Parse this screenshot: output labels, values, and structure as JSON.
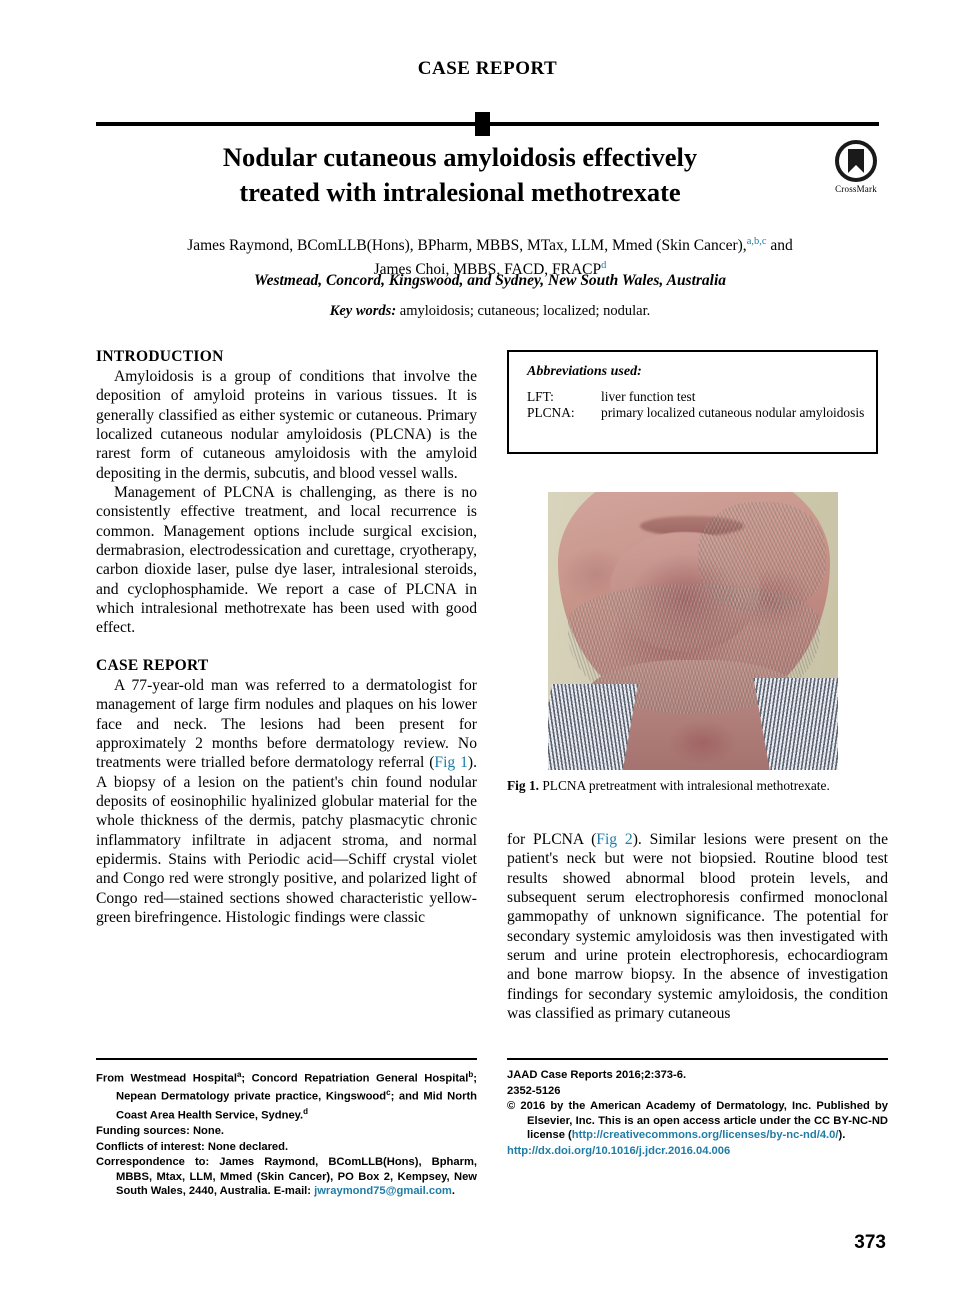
{
  "header": {
    "kicker": "CASE REPORT",
    "title_line1": "Nodular cutaneous amyloidosis effectively",
    "title_line2": "treated with intralesional methotrexate",
    "crossmark_label": "CrossMark",
    "authors_line1": "James Raymond, BComLLB(Hons), BPharm, MBBS, MTax, LLM, Mmed (Skin Cancer),",
    "authors_sup1": "a,b,c",
    "authors_and": " and",
    "authors_line2": "James Choi, MBBS, FACD, FRACP",
    "authors_sup2": "d",
    "affiliation": "Westmead, Concord, Kingswood, and Sydney, New South Wales, Australia",
    "keywords_label": "Key words:",
    "keywords_value": " amyloidosis; cutaneous; localized; nodular."
  },
  "left_column": {
    "intro_heading": "INTRODUCTION",
    "intro_p1": "Amyloidosis is a group of conditions that involve the deposition of amyloid proteins in various tissues. It is generally classified as either systemic or cutaneous. Primary localized cutaneous nodular amyloidosis (PLCNA) is the rarest form of cutaneous amyloidosis with the amyloid depositing in the dermis, subcutis, and blood vessel walls.",
    "intro_p2": "Management of PLCNA is challenging, as there is no consistently effective treatment, and local recurrence is common. Management options include surgical excision, dermabrasion, electrodessication and curettage, cryotherapy, carbon dioxide laser, pulse dye laser, intralesional steroids, and cyclophosphamide. We report a case of PLCNA in which intralesional methotrexate has been used with good effect.",
    "case_heading": "CASE REPORT",
    "case_p1_a": "A 77-year-old man was referred to a dermatologist for management of large firm nodules and plaques on his lower face and neck. The lesions had been present for approximately 2 months before dermatology review. No treatments were trialled before dermatology referral (",
    "case_p1_link": "Fig 1",
    "case_p1_b": "). A biopsy of a lesion on the patient's chin found nodular deposits of eosinophilic hyalinized globular material for the whole thickness of the dermis, patchy plasmacytic chronic inflammatory infiltrate in adjacent stroma, and normal epidermis. Stains with Periodic acid—Schiff crystal violet and Congo red were strongly positive, and polarized light of Congo red—stained sections showed characteristic yellow-green birefringence. Histologic findings were classic"
  },
  "right_column": {
    "abbrev_title": "Abbreviations used:",
    "abbreviations": [
      {
        "key": "LFT:",
        "value": "liver function test"
      },
      {
        "key": "PLCNA:",
        "value": "primary localized cutaneous nodular amyloidosis"
      }
    ],
    "figure_caption_label": "Fig 1.",
    "figure_caption_text": " PLCNA pretreatment with intralesional methotrexate.",
    "body_a": "for PLCNA (",
    "body_link": "Fig 2",
    "body_b": "). Similar lesions were present on the patient's neck but were not biopsied. Routine blood test results showed abnormal blood protein levels, and subsequent serum electrophoresis confirmed monoclonal gammopathy of unknown significance. The potential for secondary systemic amyloidosis was then investigated with serum and urine protein electrophoresis, echocardiogram and bone marrow biopsy. In the absence of investigation findings for secondary systemic amyloidosis, the condition was classified as primary cutaneous"
  },
  "footnotes_left": {
    "affiliation_a": "From Westmead Hospital",
    "affiliation_sup_a": "a",
    "affiliation_b": "; Concord Repatriation General Hospital",
    "affiliation_sup_b": "b",
    "affiliation_c": "; Nepean Dermatology private practice, Kingswood",
    "affiliation_sup_c": "c",
    "affiliation_d": "; and Mid North Coast Area Health Service, Sydney.",
    "affiliation_sup_d": "d",
    "funding": "Funding sources: None.",
    "conflicts": "Conflicts of interest: None declared.",
    "correspondence_pre": "Correspondence to: James Raymond, BComLLB(Hons), Bpharm, MBBS, Mtax, LLM, Mmed (Skin Cancer), PO Box 2, Kempsey, New South Wales, 2440, Australia. E-mail: ",
    "correspondence_email": "jwraymond75@gmail.com",
    "correspondence_post": "."
  },
  "footnotes_right": {
    "citation": "JAAD Case Reports 2016;2:373-6.",
    "issn": "2352-5126",
    "copyright_pre": "© 2016 by the American Academy of Dermatology, Inc. Published by Elsevier, Inc. This is an open access article under the CC BY-NC-ND license (",
    "license_url": "http://creativecommons.org/licenses/by-nc-nd/4.0/",
    "copyright_post": ").",
    "doi": "http://dx.doi.org/10.1016/j.jdcr.2016.04.006"
  },
  "page_number": "373",
  "colors": {
    "link": "#1f7ca6",
    "text": "#000000",
    "background": "#ffffff"
  }
}
